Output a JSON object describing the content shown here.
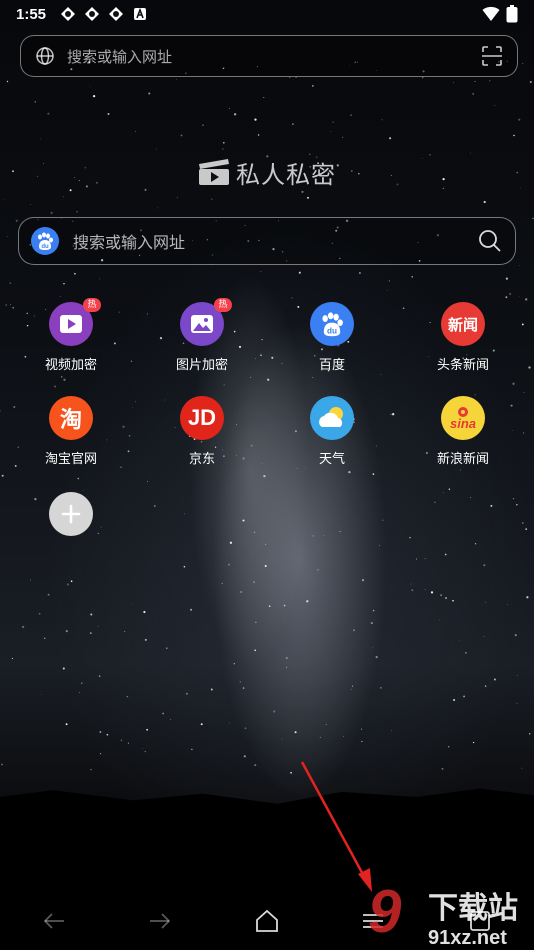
{
  "status_bar": {
    "time": "1:55"
  },
  "top_search": {
    "placeholder": "搜索或输入网址"
  },
  "brand": {
    "title": "私人私密"
  },
  "main_search": {
    "placeholder": "搜索或输入网址"
  },
  "shortcuts": [
    {
      "label": "视频加密",
      "hot": "热",
      "color": "#8a3fbf",
      "icon": "video-lock-icon"
    },
    {
      "label": "图片加密",
      "hot": "热",
      "color": "#7a48c8",
      "icon": "image-lock-icon"
    },
    {
      "label": "百度",
      "color": "#3a80f3",
      "icon": "baidu-icon"
    },
    {
      "label": "头条新闻",
      "badge_text": "新闻",
      "color": "#e83a34",
      "icon": "toutiao-icon"
    },
    {
      "label": "淘宝官网",
      "badge_text": "淘",
      "color": "#f7531c",
      "icon": "taobao-icon"
    },
    {
      "label": "京东",
      "badge_text": "JD",
      "color": "#e1251b",
      "icon": "jd-icon"
    },
    {
      "label": "天气",
      "color": "#3aa7e8",
      "icon": "weather-icon"
    },
    {
      "label": "新浪新闻",
      "badge_text": "sina",
      "color": "#f6d53a",
      "icon": "sina-icon"
    }
  ],
  "add_shortcut": {
    "icon": "plus-icon"
  },
  "watermark": {
    "text1": "下载站",
    "text2": "91xz.net",
    "number": "9"
  }
}
